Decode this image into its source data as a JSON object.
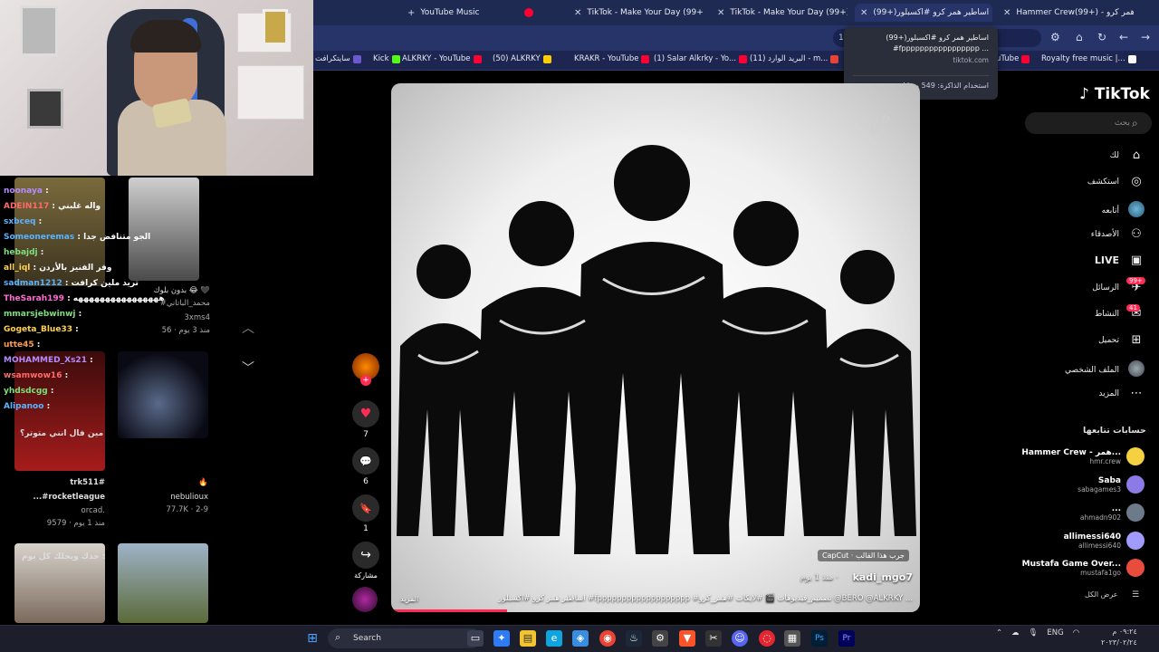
{
  "browser": {
    "tabs": [
      {
        "label": "YouTube Music",
        "favicon_color": "#ff0033"
      },
      {
        "label": "TikTok - Make Your Day (99+)",
        "favicon_color": "#ffffff"
      },
      {
        "label": "TikTok - Make Your Day (99+)",
        "favicon_color": "#ffffff"
      },
      {
        "label": "(99+)اساطير همر كرو #اكسبلور",
        "favicon_color": "#ffffff"
      },
      {
        "label": "Hammer Crew(99+) - همر كرو",
        "favicon_color": "#ffffff"
      }
    ],
    "url_fragment": "191489813",
    "bookmarks": [
      {
        "label": "سايتكرافت",
        "color": "#6a5acd"
      },
      {
        "label": "Kick",
        "color": "#53fc18"
      },
      {
        "label": "ALKRKY - YouTube",
        "color": "#ff0033"
      },
      {
        "label": "(50) ALKRKY",
        "color": "#ffcc00"
      },
      {
        "label": "KRAKR - YouTube",
        "color": "#ff0033"
      },
      {
        "label": "(1) Salar Alkrky - Yo...",
        "color": "#ff0033"
      },
      {
        "label": "(11) البريد الوارد - m...",
        "color": "#ea4335"
      },
      {
        "label": "uTube",
        "color": "#ff0033"
      },
      {
        "label": "Royalty free music |...",
        "color": "#ffffff"
      }
    ],
    "tooltip": {
      "title": "(99+)اساطير همر كرو #اكسبلور #fppppppppppppppppp ...",
      "domain": "tiktok.com",
      "memory": "استخدام الذاكرة: 549 ميغابايت"
    }
  },
  "chat": [
    {
      "user": "noonaya",
      "msg": ":",
      "color": "#b48cff"
    },
    {
      "user": "ADEIN117",
      "msg": ": واله غلبني",
      "color": "#ff6a6a"
    },
    {
      "user": "sxbceq",
      "msg": ":",
      "color": "#5ab4ff"
    },
    {
      "user": "Someoneremas",
      "msg": ": الجو متنافض جدا",
      "color": "#5ab4ff"
    },
    {
      "user": "hebajdj",
      "msg": ":",
      "color": "#7ee07e"
    },
    {
      "user": "all_iql",
      "msg": ": وفر الفنيز بالأردن",
      "color": "#ffd34d"
    },
    {
      "user": "sadman1212",
      "msg": ": تريد ملين كرافت",
      "color": "#5ab4ff"
    },
    {
      "user": "TheSarah199",
      "msg": ": ههههههههههههههههه",
      "color": "#ff6ad5"
    },
    {
      "user": "mmarsjebwinwj",
      "msg": ":",
      "color": "#7ee07e"
    },
    {
      "user": "Gogeta_Blue33",
      "msg": ":",
      "color": "#ffd34d"
    },
    {
      "user": "utte45",
      "msg": ":",
      "color": "#ff9a4d"
    },
    {
      "user": "MOHAMMED_Xs21",
      "msg": ":",
      "color": "#b48cff"
    },
    {
      "user": "wsamwow16",
      "msg": ":",
      "color": "#ff6a6a"
    },
    {
      "user": "yhdsdcgg",
      "msg": ":",
      "color": "#7ee07e"
    },
    {
      "user": "Alipanoo",
      "msg": ":",
      "color": "#5ab4ff"
    }
  ],
  "side_videos": [
    {
      "title": "بدون بلوك 😂 🖤",
      "user": "#محمد_الباتاني",
      "handle": "3xms4",
      "meta": "منذ 3 يوم · 56"
    },
    {
      "title": "مين فال انني متوتر؟",
      "user": "",
      "handle": "",
      "meta": ""
    },
    {
      "title": "trk511#",
      "user": "...#rocketleague",
      "handle": "orcad.",
      "meta": "9579 · منذ 1 يوم"
    },
    {
      "title": "🔥",
      "user": "nebulioux",
      "handle": "",
      "meta": "77.7K · 2-9"
    },
    {
      "title": "جدك ويجلك كل يوم :",
      "user": "",
      "handle": "",
      "meta": ""
    }
  ],
  "video": {
    "capcut_badge": "CapCut · جرب هذا القالب",
    "username": "kadi_mgo7",
    "time": "منذ 1 يوم ·",
    "caption": "اساطير همر كرو #اكسبلور #fppppppppppppppppppp #تصميم_فيديوهات 🎬 #لايكات #همر_كرو @BERO @ALKRKY ...",
    "more": "المزيد",
    "progress": 0.22,
    "capcut_logo": "CapCut"
  },
  "actions": [
    {
      "name": "like",
      "icon": "♥",
      "count": "7",
      "color": "#fe2c55"
    },
    {
      "name": "comment",
      "icon": "💬",
      "count": "6",
      "color": "#ffffff"
    },
    {
      "name": "bookmark",
      "icon": "🔖",
      "count": "1",
      "color": "#ffffff"
    },
    {
      "name": "share",
      "icon": "↪",
      "count": "مشاركة",
      "color": "#ffffff"
    }
  ],
  "sidebar": {
    "logo": "TikTok",
    "search_placeholder": "بحث",
    "nav": [
      {
        "label": "لك",
        "icon": "⌂"
      },
      {
        "label": "استكشف",
        "icon": "◎"
      },
      {
        "label": "أتابعه",
        "icon": "●"
      },
      {
        "label": "الأصدقاء",
        "icon": "👥"
      },
      {
        "label": "LIVE",
        "icon": "▶"
      },
      {
        "label": "الرسائل",
        "icon": "✈",
        "badge": "99+"
      },
      {
        "label": "النشاط",
        "icon": "✉",
        "badge": "41"
      },
      {
        "label": "تحميل",
        "icon": "+"
      },
      {
        "label": "الملف الشخصي",
        "icon": "◉"
      },
      {
        "label": "المزيد",
        "icon": "⋯"
      }
    ],
    "following_header": "حسابات تتابعها",
    "following": [
      {
        "name": "Hammer Crew - همر...",
        "handle": "hmr.crew",
        "color": "#f5d142"
      },
      {
        "name": "Saba",
        "handle": "sabagames3",
        "color": "#8c7ae6"
      },
      {
        "name": "...",
        "handle": "ahmadn902",
        "color": "#6c7a89"
      },
      {
        "name": "allimessi640",
        "handle": "allimessi640",
        "color": "#a29bfe"
      },
      {
        "name": "Mustafa Game Over...",
        "handle": "mustafa1go",
        "color": "#e74c3c"
      }
    ],
    "see_all": "عرض الكل"
  },
  "taskbar": {
    "search_label": "Search",
    "lang": "ENG",
    "time": "٠٩:٢٤ م",
    "date": "٢٠٢٣/٠٢/٢٤"
  }
}
